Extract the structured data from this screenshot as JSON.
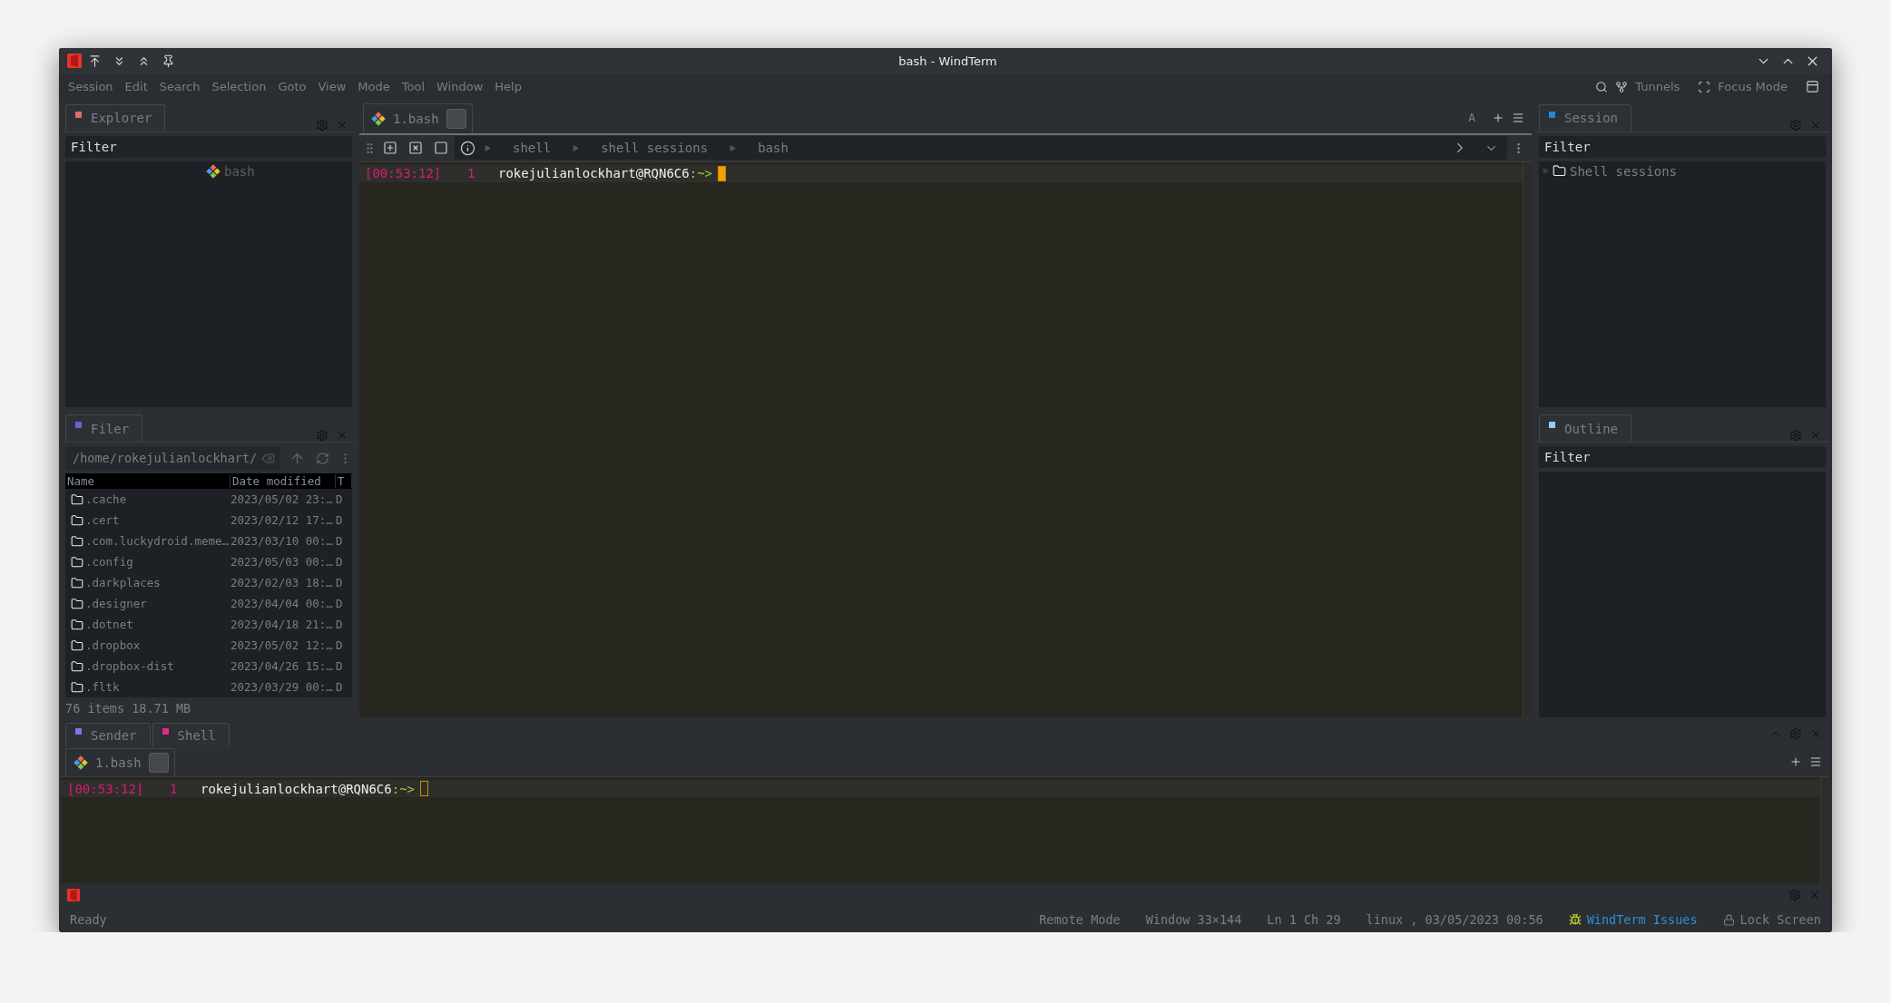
{
  "window": {
    "title": "bash - WindTerm"
  },
  "menu": [
    "Session",
    "Edit",
    "Search",
    "Selection",
    "Goto",
    "View",
    "Mode",
    "Tool",
    "Window",
    "Help"
  ],
  "toolbar": [
    {
      "kind": "tunnels",
      "label": "Tunnels"
    },
    {
      "kind": "focus",
      "label": "Focus Mode"
    }
  ],
  "explorer": {
    "tab": {
      "label": "Explorer",
      "color": "#e46a6a"
    },
    "placeholder": "Filter",
    "items": [
      {
        "label": "bash"
      }
    ]
  },
  "filer": {
    "tab": {
      "label": "Filer",
      "color": "#6466c8"
    },
    "path": "/home/rokejulianlockhart/",
    "columns": [
      "Name",
      "Date modified",
      "T"
    ],
    "rows": [
      {
        "name": ".cache",
        "date": "2023/05/02 23:…",
        "type": "D"
      },
      {
        "name": ".cert",
        "date": "2023/02/12 17:…",
        "type": "D"
      },
      {
        "name": ".com.luckydroid.meme…",
        "date": "2023/03/10 00:…",
        "type": "D"
      },
      {
        "name": ".config",
        "date": "2023/05/03 00:…",
        "type": "D"
      },
      {
        "name": ".darkplaces",
        "date": "2023/02/03 18:…",
        "type": "D"
      },
      {
        "name": ".designer",
        "date": "2023/04/04 00:…",
        "type": "D"
      },
      {
        "name": ".dotnet",
        "date": "2023/04/18 21:…",
        "type": "D"
      },
      {
        "name": ".dropbox",
        "date": "2023/05/02 12:…",
        "type": "D"
      },
      {
        "name": ".dropbox-dist",
        "date": "2023/04/26 15:…",
        "type": "D"
      },
      {
        "name": ".fltk",
        "date": "2023/03/29 00:…",
        "type": "D"
      }
    ],
    "footer": "76 items 18.71 MB"
  },
  "center": {
    "tabs": [
      {
        "label": "1.bash"
      }
    ],
    "extra": "A",
    "breadcrumb": [
      "shell",
      "shell sessions",
      "bash"
    ],
    "lines": [
      {
        "time": "[00:53:12]",
        "number": "1",
        "user": "rokejulianlockhart@RQN6C6",
        "prompt": ":~>",
        "focused": true
      }
    ]
  },
  "session": {
    "tab": {
      "label": "Session",
      "color": "#1e88e5"
    },
    "placeholder": "Filter",
    "tree": [
      {
        "label": "Shell sessions",
        "expanded": false
      }
    ]
  },
  "outline": {
    "tab": {
      "label": "Outline",
      "color": "#8ed0f4"
    },
    "placeholder": "Filter"
  },
  "bottom": {
    "tabs": [
      {
        "label": "Sender",
        "color": "#8a6fe0"
      },
      {
        "label": "Shell",
        "color": "#e8248c"
      }
    ],
    "session_tabs": [
      {
        "label": "1.bash"
      }
    ],
    "lines": [
      {
        "time": "[00:53:12]",
        "number": "1",
        "user": "rokejulianlockhart@RQN6C6",
        "prompt": ":~>",
        "focused": false
      }
    ]
  },
  "status_bar": {
    "message": "Ready",
    "items": [
      "Remote Mode",
      "Window 33×144",
      "Ln 1  Ch 29",
      "linux , 03/05/2023 00:56"
    ],
    "issues": "WindTerm Issues",
    "lock": "Lock Screen"
  }
}
